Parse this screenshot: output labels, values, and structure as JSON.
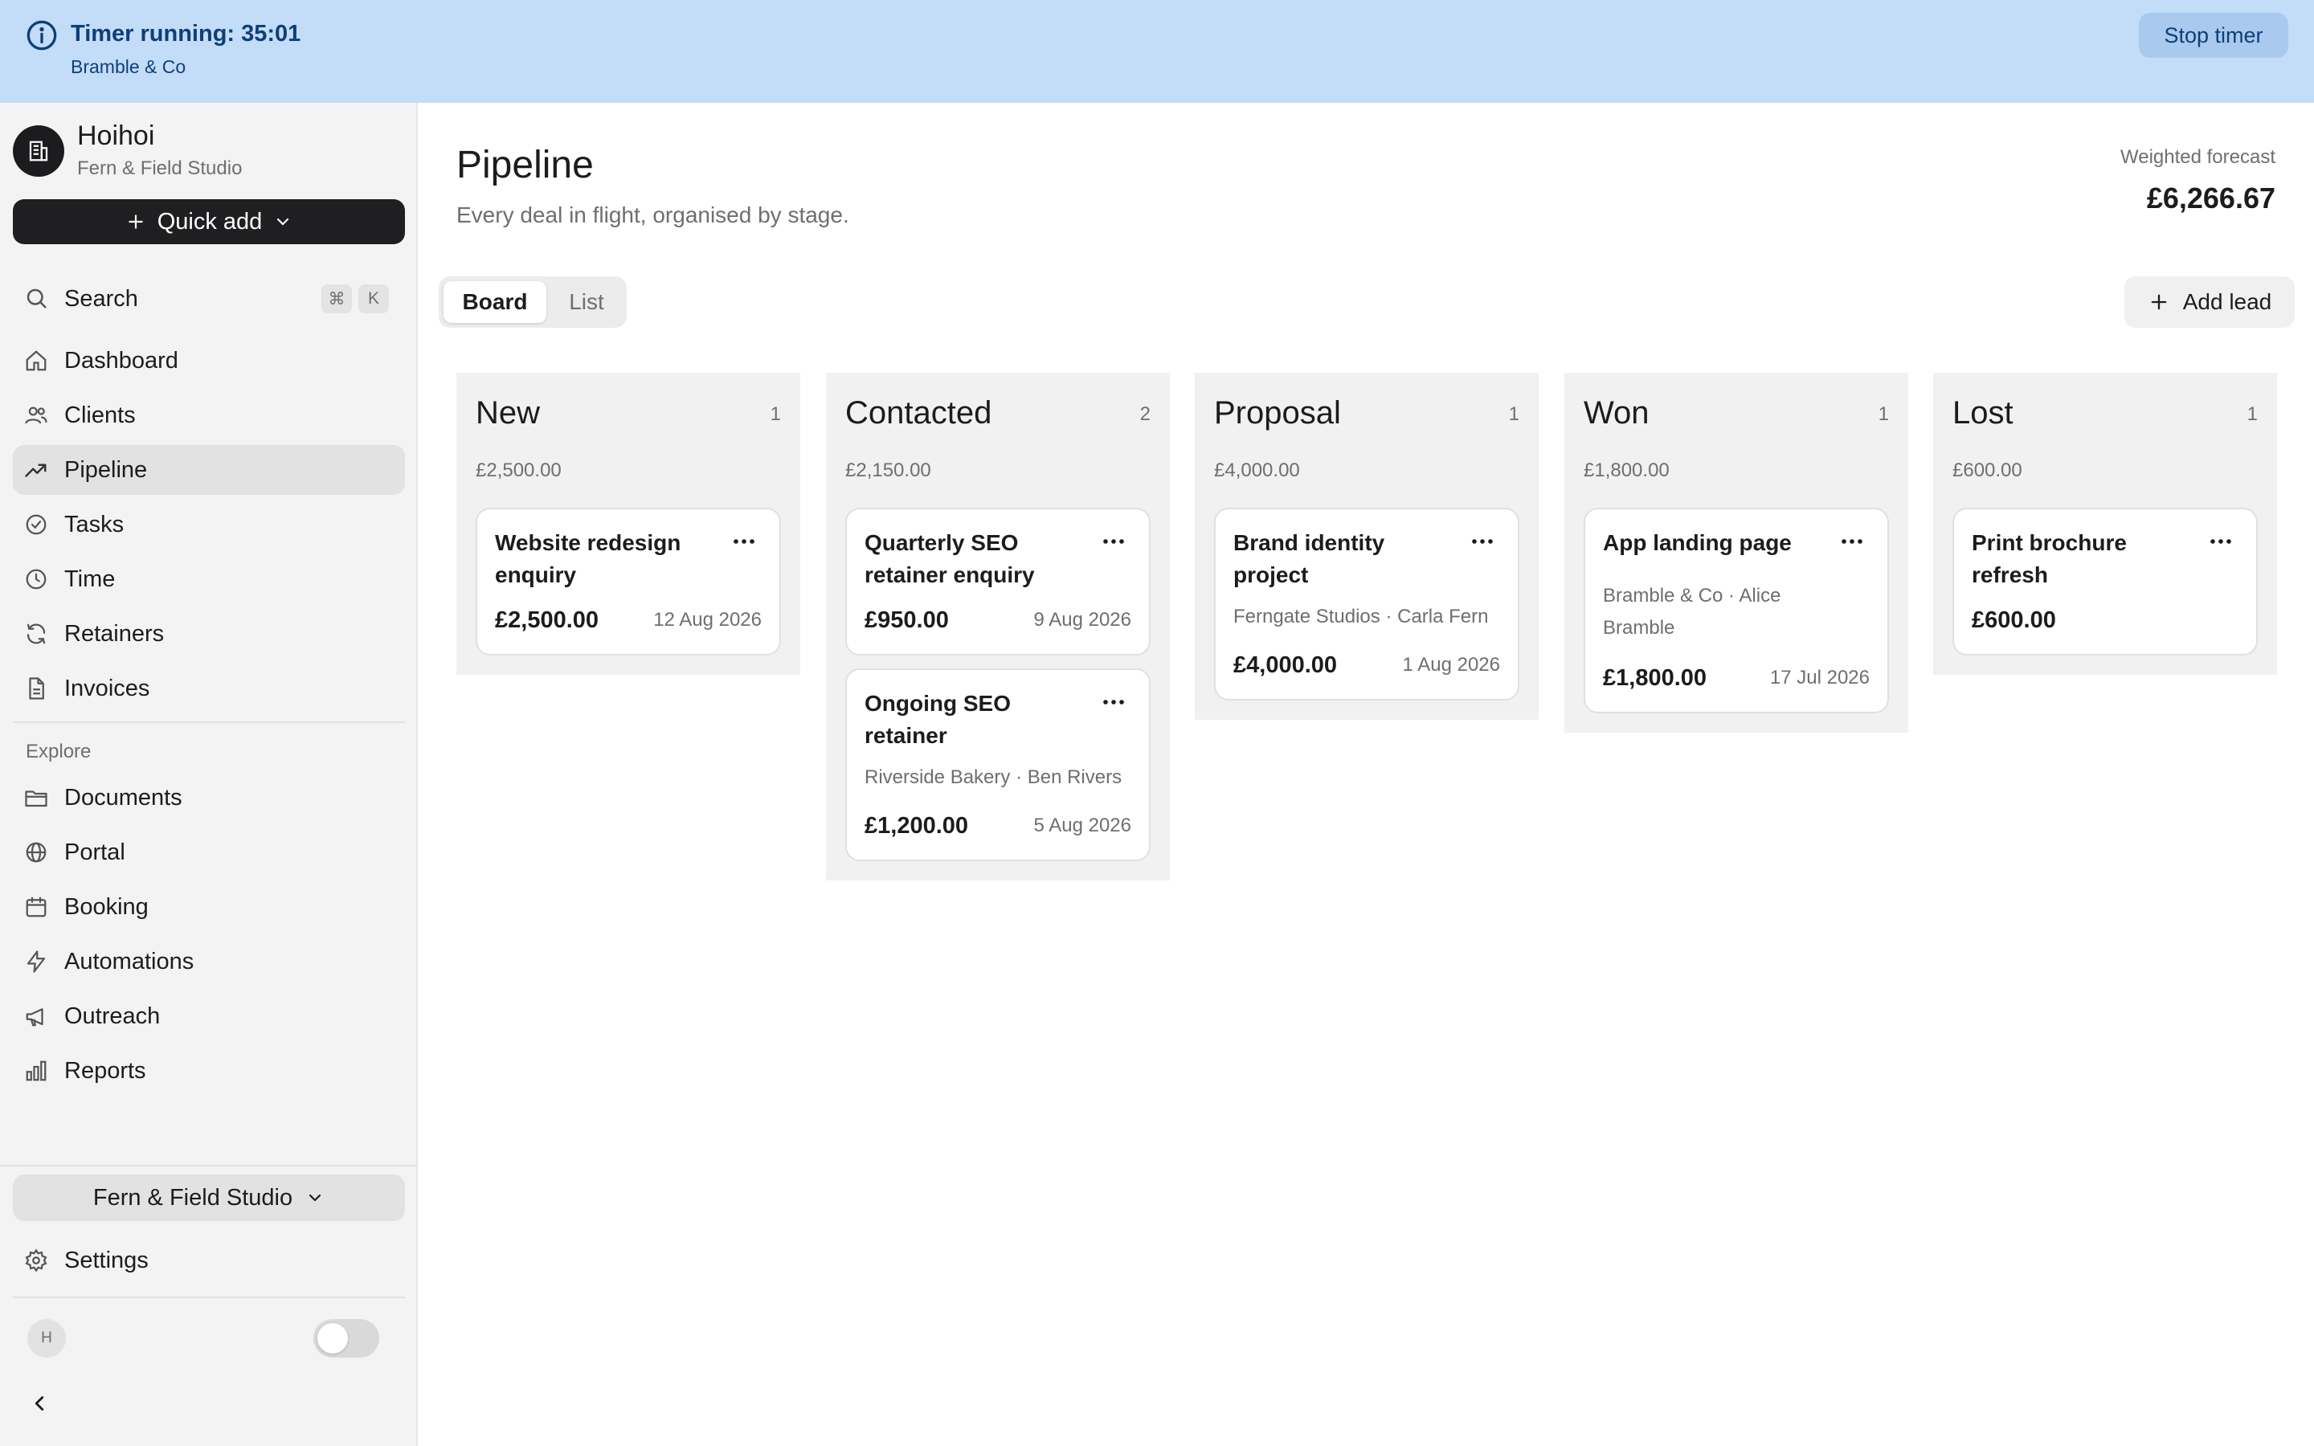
{
  "banner": {
    "title": "Timer running: 35:01",
    "client": "Bramble & Co",
    "stop_label": "Stop timer"
  },
  "sidebar": {
    "workspace_name": "Hoihoi",
    "workspace_sub": "Fern & Field Studio",
    "quick_add_label": "Quick add",
    "search_label": "Search",
    "search_shortcut": [
      "⌘",
      "K"
    ],
    "items": [
      {
        "label": "Dashboard",
        "icon": "home-icon"
      },
      {
        "label": "Clients",
        "icon": "users-icon"
      },
      {
        "label": "Pipeline",
        "icon": "trending-up-icon",
        "active": true
      },
      {
        "label": "Tasks",
        "icon": "check-circle-icon"
      },
      {
        "label": "Time",
        "icon": "clock-icon"
      },
      {
        "label": "Retainers",
        "icon": "refresh-icon"
      },
      {
        "label": "Invoices",
        "icon": "file-icon"
      }
    ],
    "explore_label": "Explore",
    "explore_items": [
      {
        "label": "Documents",
        "icon": "folder-icon"
      },
      {
        "label": "Portal",
        "icon": "globe-icon"
      },
      {
        "label": "Booking",
        "icon": "calendar-icon"
      },
      {
        "label": "Automations",
        "icon": "zap-icon"
      },
      {
        "label": "Outreach",
        "icon": "megaphone-icon"
      },
      {
        "label": "Reports",
        "icon": "bar-chart-icon"
      }
    ],
    "workspace_switch_label": "Fern & Field Studio",
    "settings_label": "Settings",
    "user_initial": "H"
  },
  "main": {
    "title": "Pipeline",
    "subtitle": "Every deal in flight, organised by stage.",
    "forecast_label": "Weighted forecast",
    "forecast_value": "£6,266.67",
    "view_board": "Board",
    "view_list": "List",
    "add_lead_label": "Add lead"
  },
  "columns": [
    {
      "title": "New",
      "count": "1",
      "total": "£2,500.00",
      "cards": [
        {
          "title": "Website redesign enquiry",
          "meta": "",
          "value": "£2,500.00",
          "date": "12 Aug 2026"
        }
      ]
    },
    {
      "title": "Contacted",
      "count": "2",
      "total": "£2,150.00",
      "cards": [
        {
          "title": "Quarterly SEO retainer enquiry",
          "meta": "",
          "value": "£950.00",
          "date": "9 Aug 2026"
        },
        {
          "title": "Ongoing SEO retainer",
          "meta": "Riverside Bakery · Ben Rivers",
          "value": "£1,200.00",
          "date": "5 Aug 2026"
        }
      ]
    },
    {
      "title": "Proposal",
      "count": "1",
      "total": "£4,000.00",
      "cards": [
        {
          "title": "Brand identity project",
          "meta": "Ferngate Studios · Carla Fern",
          "value": "£4,000.00",
          "date": "1 Aug 2026"
        }
      ]
    },
    {
      "title": "Won",
      "count": "1",
      "total": "£1,800.00",
      "cards": [
        {
          "title": "App landing page",
          "meta": "Bramble & Co · Alice Bramble",
          "value": "£1,800.00",
          "date": "17 Jul 2026"
        }
      ]
    },
    {
      "title": "Lost",
      "count": "1",
      "total": "£600.00",
      "cards": [
        {
          "title": "Print brochure refresh",
          "meta": "",
          "value": "£600.00",
          "date": ""
        }
      ]
    }
  ]
}
